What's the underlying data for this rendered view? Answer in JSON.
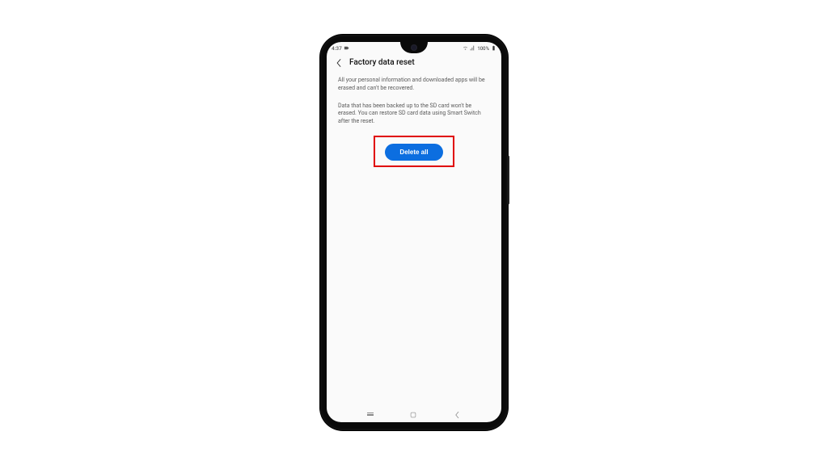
{
  "status": {
    "time": "4:37",
    "battery_text": "100%"
  },
  "header": {
    "title": "Factory data reset"
  },
  "content": {
    "paragraph1": "All your personal information and downloaded apps will be erased and can't be recovered.",
    "paragraph2": "Data that has been backed up to the SD card won't be erased. You can restore SD card data using Smart Switch after the reset."
  },
  "button": {
    "label": "Delete all"
  },
  "colors": {
    "primary_button": "#0c6ee0",
    "highlight_border": "#e00000"
  }
}
